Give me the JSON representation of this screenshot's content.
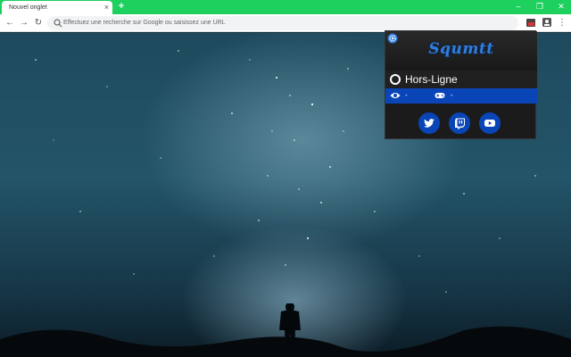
{
  "browser": {
    "tab_title": "Nouvel onglet",
    "tab_close": "×",
    "new_tab": "+",
    "window_controls": {
      "minimize": "–",
      "maximize": "❐",
      "close": "✕"
    },
    "omnibox_placeholder": "Effectuez une recherche sur Google ou saisissez une URL",
    "nav": {
      "back": "←",
      "forward": "→",
      "reload": "↻"
    },
    "frame_color": "#1ed05e"
  },
  "popup": {
    "banner_title": "Squmtt",
    "status_text": "Hors-Ligne",
    "viewers_value": "-",
    "games_value": "-",
    "accent_color": "#0a45b8",
    "social": [
      {
        "icon": "twitter-icon"
      },
      {
        "icon": "twitch-icon"
      },
      {
        "icon": "youtube-icon"
      }
    ]
  }
}
